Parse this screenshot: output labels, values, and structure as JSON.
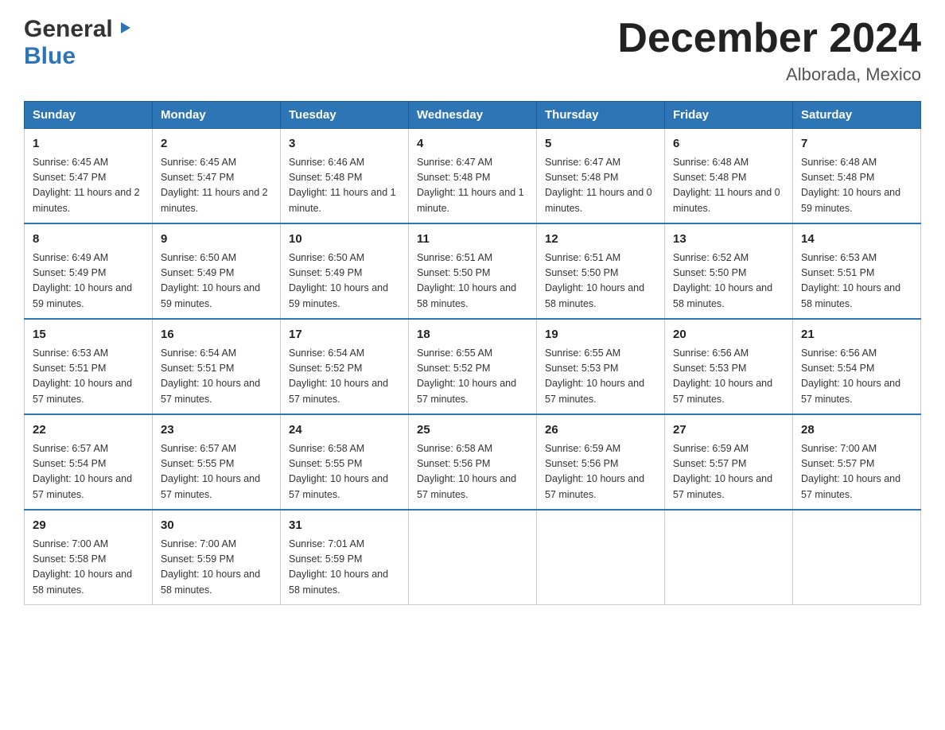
{
  "header": {
    "logo_general": "General",
    "logo_blue": "Blue",
    "month_title": "December 2024",
    "location": "Alborada, Mexico"
  },
  "days_of_week": [
    "Sunday",
    "Monday",
    "Tuesday",
    "Wednesday",
    "Thursday",
    "Friday",
    "Saturday"
  ],
  "weeks": [
    [
      {
        "day": "1",
        "sunrise": "Sunrise: 6:45 AM",
        "sunset": "Sunset: 5:47 PM",
        "daylight": "Daylight: 11 hours and 2 minutes."
      },
      {
        "day": "2",
        "sunrise": "Sunrise: 6:45 AM",
        "sunset": "Sunset: 5:47 PM",
        "daylight": "Daylight: 11 hours and 2 minutes."
      },
      {
        "day": "3",
        "sunrise": "Sunrise: 6:46 AM",
        "sunset": "Sunset: 5:48 PM",
        "daylight": "Daylight: 11 hours and 1 minute."
      },
      {
        "day": "4",
        "sunrise": "Sunrise: 6:47 AM",
        "sunset": "Sunset: 5:48 PM",
        "daylight": "Daylight: 11 hours and 1 minute."
      },
      {
        "day": "5",
        "sunrise": "Sunrise: 6:47 AM",
        "sunset": "Sunset: 5:48 PM",
        "daylight": "Daylight: 11 hours and 0 minutes."
      },
      {
        "day": "6",
        "sunrise": "Sunrise: 6:48 AM",
        "sunset": "Sunset: 5:48 PM",
        "daylight": "Daylight: 11 hours and 0 minutes."
      },
      {
        "day": "7",
        "sunrise": "Sunrise: 6:48 AM",
        "sunset": "Sunset: 5:48 PM",
        "daylight": "Daylight: 10 hours and 59 minutes."
      }
    ],
    [
      {
        "day": "8",
        "sunrise": "Sunrise: 6:49 AM",
        "sunset": "Sunset: 5:49 PM",
        "daylight": "Daylight: 10 hours and 59 minutes."
      },
      {
        "day": "9",
        "sunrise": "Sunrise: 6:50 AM",
        "sunset": "Sunset: 5:49 PM",
        "daylight": "Daylight: 10 hours and 59 minutes."
      },
      {
        "day": "10",
        "sunrise": "Sunrise: 6:50 AM",
        "sunset": "Sunset: 5:49 PM",
        "daylight": "Daylight: 10 hours and 59 minutes."
      },
      {
        "day": "11",
        "sunrise": "Sunrise: 6:51 AM",
        "sunset": "Sunset: 5:50 PM",
        "daylight": "Daylight: 10 hours and 58 minutes."
      },
      {
        "day": "12",
        "sunrise": "Sunrise: 6:51 AM",
        "sunset": "Sunset: 5:50 PM",
        "daylight": "Daylight: 10 hours and 58 minutes."
      },
      {
        "day": "13",
        "sunrise": "Sunrise: 6:52 AM",
        "sunset": "Sunset: 5:50 PM",
        "daylight": "Daylight: 10 hours and 58 minutes."
      },
      {
        "day": "14",
        "sunrise": "Sunrise: 6:53 AM",
        "sunset": "Sunset: 5:51 PM",
        "daylight": "Daylight: 10 hours and 58 minutes."
      }
    ],
    [
      {
        "day": "15",
        "sunrise": "Sunrise: 6:53 AM",
        "sunset": "Sunset: 5:51 PM",
        "daylight": "Daylight: 10 hours and 57 minutes."
      },
      {
        "day": "16",
        "sunrise": "Sunrise: 6:54 AM",
        "sunset": "Sunset: 5:51 PM",
        "daylight": "Daylight: 10 hours and 57 minutes."
      },
      {
        "day": "17",
        "sunrise": "Sunrise: 6:54 AM",
        "sunset": "Sunset: 5:52 PM",
        "daylight": "Daylight: 10 hours and 57 minutes."
      },
      {
        "day": "18",
        "sunrise": "Sunrise: 6:55 AM",
        "sunset": "Sunset: 5:52 PM",
        "daylight": "Daylight: 10 hours and 57 minutes."
      },
      {
        "day": "19",
        "sunrise": "Sunrise: 6:55 AM",
        "sunset": "Sunset: 5:53 PM",
        "daylight": "Daylight: 10 hours and 57 minutes."
      },
      {
        "day": "20",
        "sunrise": "Sunrise: 6:56 AM",
        "sunset": "Sunset: 5:53 PM",
        "daylight": "Daylight: 10 hours and 57 minutes."
      },
      {
        "day": "21",
        "sunrise": "Sunrise: 6:56 AM",
        "sunset": "Sunset: 5:54 PM",
        "daylight": "Daylight: 10 hours and 57 minutes."
      }
    ],
    [
      {
        "day": "22",
        "sunrise": "Sunrise: 6:57 AM",
        "sunset": "Sunset: 5:54 PM",
        "daylight": "Daylight: 10 hours and 57 minutes."
      },
      {
        "day": "23",
        "sunrise": "Sunrise: 6:57 AM",
        "sunset": "Sunset: 5:55 PM",
        "daylight": "Daylight: 10 hours and 57 minutes."
      },
      {
        "day": "24",
        "sunrise": "Sunrise: 6:58 AM",
        "sunset": "Sunset: 5:55 PM",
        "daylight": "Daylight: 10 hours and 57 minutes."
      },
      {
        "day": "25",
        "sunrise": "Sunrise: 6:58 AM",
        "sunset": "Sunset: 5:56 PM",
        "daylight": "Daylight: 10 hours and 57 minutes."
      },
      {
        "day": "26",
        "sunrise": "Sunrise: 6:59 AM",
        "sunset": "Sunset: 5:56 PM",
        "daylight": "Daylight: 10 hours and 57 minutes."
      },
      {
        "day": "27",
        "sunrise": "Sunrise: 6:59 AM",
        "sunset": "Sunset: 5:57 PM",
        "daylight": "Daylight: 10 hours and 57 minutes."
      },
      {
        "day": "28",
        "sunrise": "Sunrise: 7:00 AM",
        "sunset": "Sunset: 5:57 PM",
        "daylight": "Daylight: 10 hours and 57 minutes."
      }
    ],
    [
      {
        "day": "29",
        "sunrise": "Sunrise: 7:00 AM",
        "sunset": "Sunset: 5:58 PM",
        "daylight": "Daylight: 10 hours and 58 minutes."
      },
      {
        "day": "30",
        "sunrise": "Sunrise: 7:00 AM",
        "sunset": "Sunset: 5:59 PM",
        "daylight": "Daylight: 10 hours and 58 minutes."
      },
      {
        "day": "31",
        "sunrise": "Sunrise: 7:01 AM",
        "sunset": "Sunset: 5:59 PM",
        "daylight": "Daylight: 10 hours and 58 minutes."
      },
      null,
      null,
      null,
      null
    ]
  ]
}
